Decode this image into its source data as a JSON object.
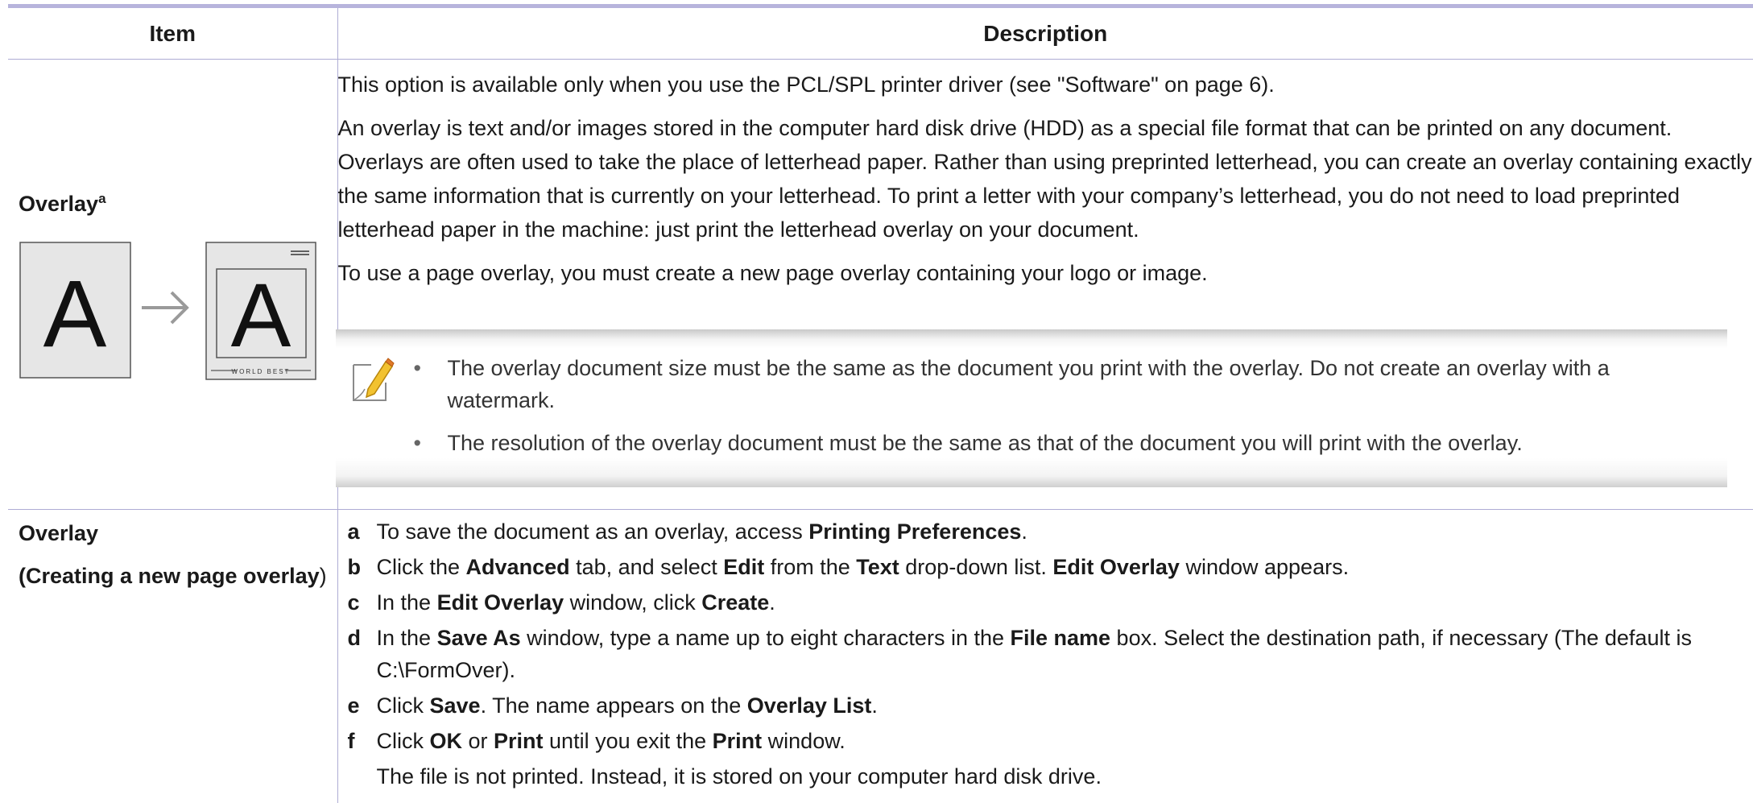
{
  "header": {
    "item": "Item",
    "description": "Description"
  },
  "row1": {
    "item": "Overlay",
    "item_sup": "a",
    "illustration": {
      "source_letter": "A",
      "result_letter": "A",
      "footer_text": "WORLD BEST"
    },
    "p1": "This option is available only when you use the PCL/SPL printer driver (see \"Software\" on page 6).",
    "p2": "An overlay is text and/or images stored in the computer hard disk drive (HDD) as a special file format that can be printed on any document. Overlays are often used to take the place of letterhead paper. Rather than using preprinted letterhead, you can create an overlay containing exactly the same information that is currently on your letterhead. To print a letter with your company’s letterhead, you do not need to load preprinted letterhead paper in the machine: just print the letterhead overlay on your document.",
    "p3": "To use a page overlay, you must create a new page overlay containing your logo or image.",
    "note": {
      "icon": "note-pencil-icon",
      "items": [
        "The overlay document size must be the same as the document you print with the overlay. Do not create an overlay with a watermark.",
        "The resolution of the overlay document must be the same as that of the document you will print with the overlay."
      ]
    }
  },
  "row2": {
    "item_line1": "Overlay",
    "item_line2_bold": "(Creating a new page overlay",
    "item_line2_end": ")",
    "steps": [
      {
        "letter": "a",
        "parts": [
          {
            "t": "To save the document as an overlay, access "
          },
          {
            "t": "Printing Preferences",
            "b": true
          },
          {
            "t": "."
          }
        ]
      },
      {
        "letter": "b",
        "parts": [
          {
            "t": "Click the "
          },
          {
            "t": "Advanced",
            "b": true
          },
          {
            "t": " tab, and select "
          },
          {
            "t": "Edit",
            "b": true
          },
          {
            "t": " from the "
          },
          {
            "t": "Text",
            "b": true
          },
          {
            "t": " drop-down list. "
          },
          {
            "t": "Edit Overlay",
            "b": true
          },
          {
            "t": " window appears."
          }
        ]
      },
      {
        "letter": "c",
        "parts": [
          {
            "t": "In the "
          },
          {
            "t": "Edit Overlay",
            "b": true
          },
          {
            "t": " window, click "
          },
          {
            "t": "Create",
            "b": true
          },
          {
            "t": "."
          }
        ]
      },
      {
        "letter": "d",
        "parts": [
          {
            "t": "In the "
          },
          {
            "t": "Save As",
            "b": true
          },
          {
            "t": " window, type a name up to eight characters in the "
          },
          {
            "t": "File name",
            "b": true
          },
          {
            "t": " box. Select the destination path, if necessary (The default is C:\\FormOver)."
          }
        ]
      },
      {
        "letter": "e",
        "parts": [
          {
            "t": "Click "
          },
          {
            "t": "Save",
            "b": true
          },
          {
            "t": ". The name appears on the "
          },
          {
            "t": "Overlay List",
            "b": true
          },
          {
            "t": "."
          }
        ]
      },
      {
        "letter": "f",
        "parts": [
          {
            "t": "Click "
          },
          {
            "t": "OK",
            "b": true
          },
          {
            "t": " or "
          },
          {
            "t": "Print",
            "b": true
          },
          {
            "t": " until you exit the "
          },
          {
            "t": "Print",
            "b": true
          },
          {
            "t": " window."
          }
        ]
      },
      {
        "letter": "",
        "parts": [
          {
            "t": "The file is not printed. Instead, it is stored on your computer hard disk drive."
          }
        ]
      }
    ]
  }
}
